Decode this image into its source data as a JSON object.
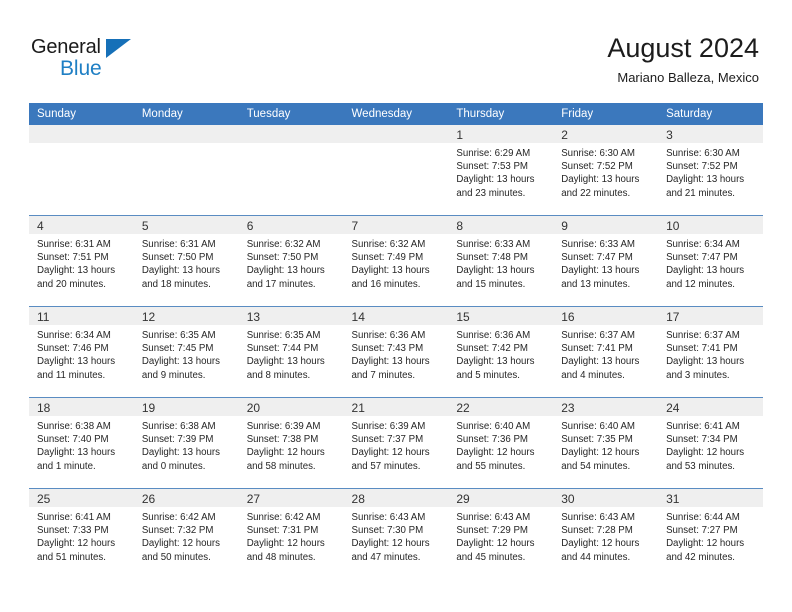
{
  "brand": {
    "name_part1": "General",
    "name_part2": "Blue",
    "accent_color": "#1f7fc4",
    "header_color": "#3b78bd"
  },
  "header": {
    "title": "August 2024",
    "subtitle": "Mariano Balleza, Mexico"
  },
  "calendar": {
    "weekday_headers": [
      "Sunday",
      "Monday",
      "Tuesday",
      "Wednesday",
      "Thursday",
      "Friday",
      "Saturday"
    ],
    "weeks": [
      [
        {
          "day": "",
          "lines": []
        },
        {
          "day": "",
          "lines": []
        },
        {
          "day": "",
          "lines": []
        },
        {
          "day": "",
          "lines": []
        },
        {
          "day": "1",
          "lines": [
            "Sunrise: 6:29 AM",
            "Sunset: 7:53 PM",
            "Daylight: 13 hours",
            "and 23 minutes."
          ]
        },
        {
          "day": "2",
          "lines": [
            "Sunrise: 6:30 AM",
            "Sunset: 7:52 PM",
            "Daylight: 13 hours",
            "and 22 minutes."
          ]
        },
        {
          "day": "3",
          "lines": [
            "Sunrise: 6:30 AM",
            "Sunset: 7:52 PM",
            "Daylight: 13 hours",
            "and 21 minutes."
          ]
        }
      ],
      [
        {
          "day": "4",
          "lines": [
            "Sunrise: 6:31 AM",
            "Sunset: 7:51 PM",
            "Daylight: 13 hours",
            "and 20 minutes."
          ]
        },
        {
          "day": "5",
          "lines": [
            "Sunrise: 6:31 AM",
            "Sunset: 7:50 PM",
            "Daylight: 13 hours",
            "and 18 minutes."
          ]
        },
        {
          "day": "6",
          "lines": [
            "Sunrise: 6:32 AM",
            "Sunset: 7:50 PM",
            "Daylight: 13 hours",
            "and 17 minutes."
          ]
        },
        {
          "day": "7",
          "lines": [
            "Sunrise: 6:32 AM",
            "Sunset: 7:49 PM",
            "Daylight: 13 hours",
            "and 16 minutes."
          ]
        },
        {
          "day": "8",
          "lines": [
            "Sunrise: 6:33 AM",
            "Sunset: 7:48 PM",
            "Daylight: 13 hours",
            "and 15 minutes."
          ]
        },
        {
          "day": "9",
          "lines": [
            "Sunrise: 6:33 AM",
            "Sunset: 7:47 PM",
            "Daylight: 13 hours",
            "and 13 minutes."
          ]
        },
        {
          "day": "10",
          "lines": [
            "Sunrise: 6:34 AM",
            "Sunset: 7:47 PM",
            "Daylight: 13 hours",
            "and 12 minutes."
          ]
        }
      ],
      [
        {
          "day": "11",
          "lines": [
            "Sunrise: 6:34 AM",
            "Sunset: 7:46 PM",
            "Daylight: 13 hours",
            "and 11 minutes."
          ]
        },
        {
          "day": "12",
          "lines": [
            "Sunrise: 6:35 AM",
            "Sunset: 7:45 PM",
            "Daylight: 13 hours",
            "and 9 minutes."
          ]
        },
        {
          "day": "13",
          "lines": [
            "Sunrise: 6:35 AM",
            "Sunset: 7:44 PM",
            "Daylight: 13 hours",
            "and 8 minutes."
          ]
        },
        {
          "day": "14",
          "lines": [
            "Sunrise: 6:36 AM",
            "Sunset: 7:43 PM",
            "Daylight: 13 hours",
            "and 7 minutes."
          ]
        },
        {
          "day": "15",
          "lines": [
            "Sunrise: 6:36 AM",
            "Sunset: 7:42 PM",
            "Daylight: 13 hours",
            "and 5 minutes."
          ]
        },
        {
          "day": "16",
          "lines": [
            "Sunrise: 6:37 AM",
            "Sunset: 7:41 PM",
            "Daylight: 13 hours",
            "and 4 minutes."
          ]
        },
        {
          "day": "17",
          "lines": [
            "Sunrise: 6:37 AM",
            "Sunset: 7:41 PM",
            "Daylight: 13 hours",
            "and 3 minutes."
          ]
        }
      ],
      [
        {
          "day": "18",
          "lines": [
            "Sunrise: 6:38 AM",
            "Sunset: 7:40 PM",
            "Daylight: 13 hours",
            "and 1 minute."
          ]
        },
        {
          "day": "19",
          "lines": [
            "Sunrise: 6:38 AM",
            "Sunset: 7:39 PM",
            "Daylight: 13 hours",
            "and 0 minutes."
          ]
        },
        {
          "day": "20",
          "lines": [
            "Sunrise: 6:39 AM",
            "Sunset: 7:38 PM",
            "Daylight: 12 hours",
            "and 58 minutes."
          ]
        },
        {
          "day": "21",
          "lines": [
            "Sunrise: 6:39 AM",
            "Sunset: 7:37 PM",
            "Daylight: 12 hours",
            "and 57 minutes."
          ]
        },
        {
          "day": "22",
          "lines": [
            "Sunrise: 6:40 AM",
            "Sunset: 7:36 PM",
            "Daylight: 12 hours",
            "and 55 minutes."
          ]
        },
        {
          "day": "23",
          "lines": [
            "Sunrise: 6:40 AM",
            "Sunset: 7:35 PM",
            "Daylight: 12 hours",
            "and 54 minutes."
          ]
        },
        {
          "day": "24",
          "lines": [
            "Sunrise: 6:41 AM",
            "Sunset: 7:34 PM",
            "Daylight: 12 hours",
            "and 53 minutes."
          ]
        }
      ],
      [
        {
          "day": "25",
          "lines": [
            "Sunrise: 6:41 AM",
            "Sunset: 7:33 PM",
            "Daylight: 12 hours",
            "and 51 minutes."
          ]
        },
        {
          "day": "26",
          "lines": [
            "Sunrise: 6:42 AM",
            "Sunset: 7:32 PM",
            "Daylight: 12 hours",
            "and 50 minutes."
          ]
        },
        {
          "day": "27",
          "lines": [
            "Sunrise: 6:42 AM",
            "Sunset: 7:31 PM",
            "Daylight: 12 hours",
            "and 48 minutes."
          ]
        },
        {
          "day": "28",
          "lines": [
            "Sunrise: 6:43 AM",
            "Sunset: 7:30 PM",
            "Daylight: 12 hours",
            "and 47 minutes."
          ]
        },
        {
          "day": "29",
          "lines": [
            "Sunrise: 6:43 AM",
            "Sunset: 7:29 PM",
            "Daylight: 12 hours",
            "and 45 minutes."
          ]
        },
        {
          "day": "30",
          "lines": [
            "Sunrise: 6:43 AM",
            "Sunset: 7:28 PM",
            "Daylight: 12 hours",
            "and 44 minutes."
          ]
        },
        {
          "day": "31",
          "lines": [
            "Sunrise: 6:44 AM",
            "Sunset: 7:27 PM",
            "Daylight: 12 hours",
            "and 42 minutes."
          ]
        }
      ]
    ]
  }
}
